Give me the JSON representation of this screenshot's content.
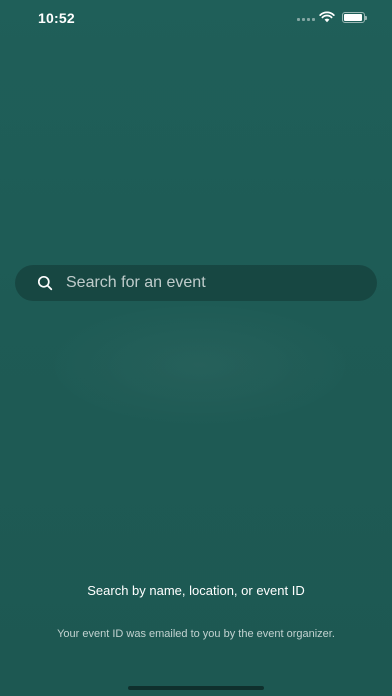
{
  "status_bar": {
    "time": "10:52",
    "battery_level": 0.95
  },
  "search": {
    "placeholder": "Search for an event",
    "value": "",
    "icon": "search-icon"
  },
  "info": {
    "title": "Search by name, location, or event ID",
    "subtitle": "Your event ID was emailed to you by the event organizer."
  },
  "colors": {
    "background": "#1e5c56",
    "text": "#ffffff"
  }
}
